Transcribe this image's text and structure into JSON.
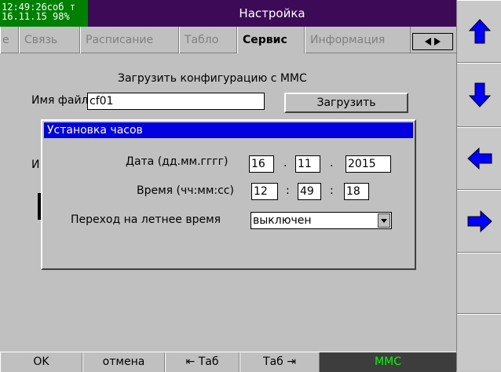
{
  "status": {
    "time": "12:49:26",
    "state": "соб т",
    "date": "16.11.15",
    "battery": "98%"
  },
  "window": {
    "title": "Настройка"
  },
  "tabs": [
    {
      "label": "е"
    },
    {
      "label": "Связь"
    },
    {
      "label": "Расписание"
    },
    {
      "label": "Табло"
    },
    {
      "label": "Сервис"
    },
    {
      "label": "Информация"
    }
  ],
  "tab_scroll": {
    "left_icon": "triangle-left",
    "right_icon": "triangle-right"
  },
  "config": {
    "load_heading": "Загрузить конфигурацию с ММС",
    "filename_label": "Имя файла",
    "filename_value": "cf01",
    "load_button": "Загрузить",
    "obscured_label": "И"
  },
  "clock_dialog": {
    "title": "Установка часов",
    "date_label": "Дата (дд.мм.гггг)",
    "date_day": "16",
    "date_month": "11",
    "date_year": "2015",
    "date_sep": ".",
    "time_label": "Время (чч:мм:сс)",
    "time_hour": "12",
    "time_min": "49",
    "time_sec": "18",
    "time_sep": ":",
    "dst_label": "Переход на летнее время",
    "dst_value": "выключен"
  },
  "bottom": {
    "ok": "OK",
    "cancel": "отмена",
    "tab_back": "⇤ Таб",
    "tab_fwd": "Таб ⇥",
    "mmc": "MMC"
  },
  "colors": {
    "status_bg": "#008000",
    "title_bg": "#3d0a57",
    "dialog_title_bg": "#0000e0",
    "arrow_fill": "#0000ff",
    "mmc_bg": "#3d3d3d",
    "mmc_text": "#00ff00"
  },
  "right_panel": {
    "buttons": [
      "arrow-up-icon",
      "arrow-down-icon",
      "arrow-left-icon",
      "arrow-right-icon"
    ]
  }
}
